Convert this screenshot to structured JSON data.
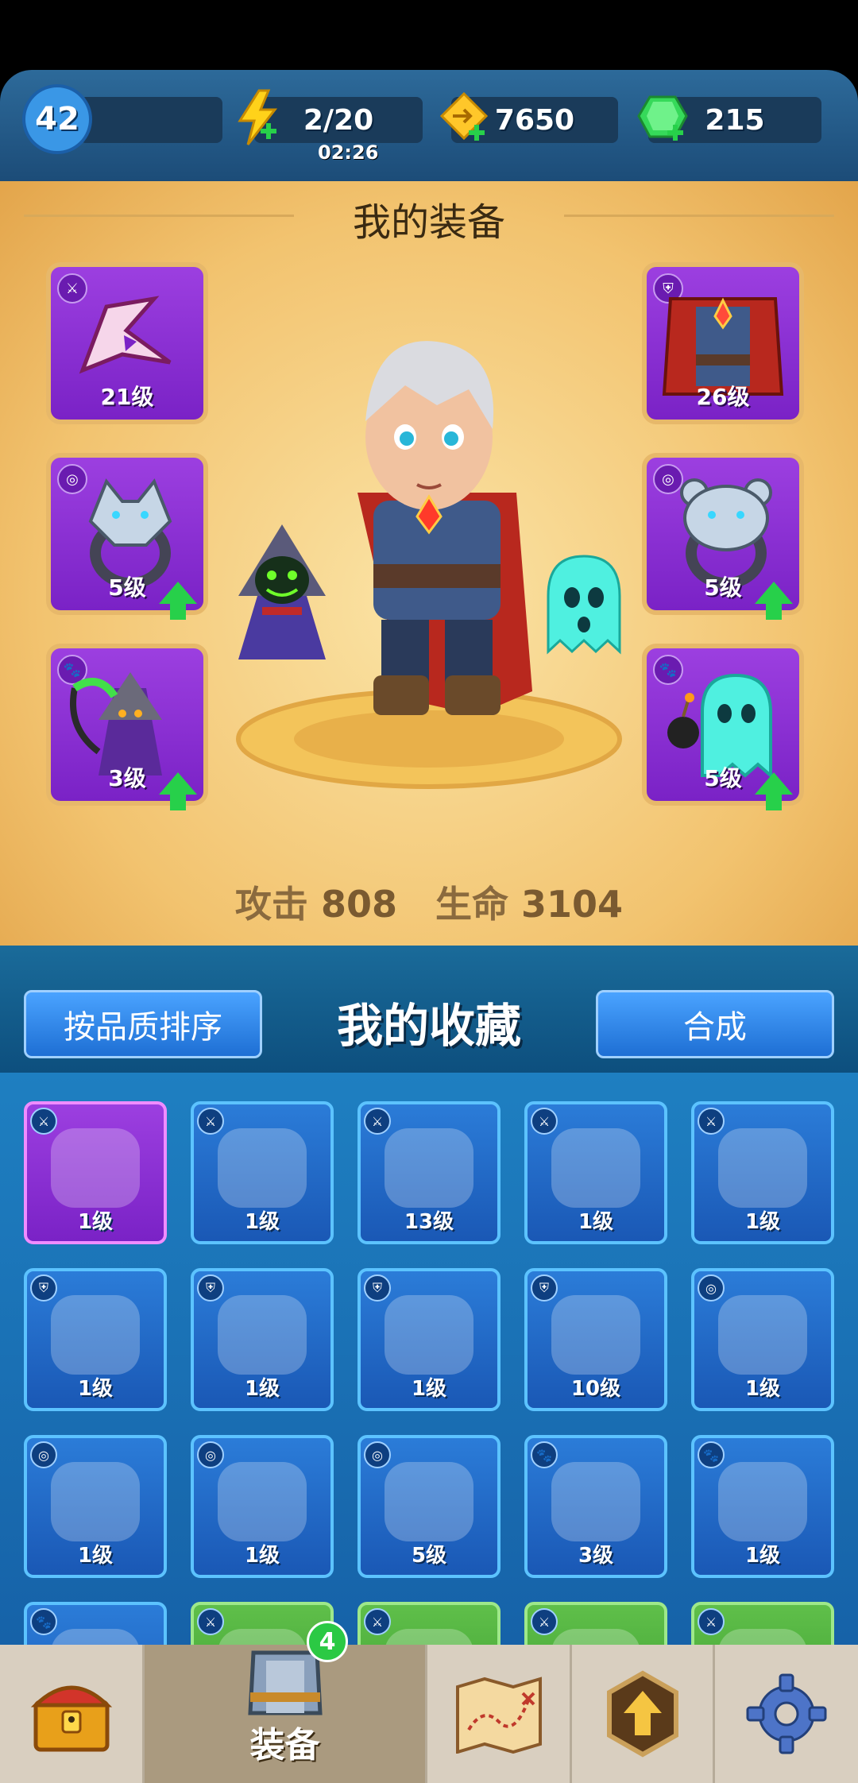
{
  "header": {
    "player_level": "42",
    "energy": "2/20",
    "energy_timer": "02:26",
    "gold": "7650",
    "gems": "215"
  },
  "equipment": {
    "title": "我的装备",
    "slots": [
      {
        "level": "21级",
        "type": "weapon",
        "upgrade": false,
        "icon": "claw-blade-icon"
      },
      {
        "level": "5级",
        "type": "ring",
        "upgrade": true,
        "icon": "wolf-ring-icon"
      },
      {
        "level": "3级",
        "type": "pet",
        "upgrade": true,
        "icon": "reaper-pet-icon"
      },
      {
        "level": "26级",
        "type": "armor",
        "upgrade": false,
        "icon": "red-cape-armor-icon"
      },
      {
        "level": "5级",
        "type": "ring",
        "upgrade": true,
        "icon": "bear-ring-icon"
      },
      {
        "level": "5级",
        "type": "pet",
        "upgrade": true,
        "icon": "ghost-bomb-pet-icon"
      }
    ],
    "stats": {
      "attack_label": "攻击",
      "attack_value": "808",
      "hp_label": "生命",
      "hp_value": "3104"
    }
  },
  "collection": {
    "title": "我的收藏",
    "sort_button": "按品质排序",
    "merge_button": "合成",
    "items": [
      {
        "level": "1级",
        "rarity": "purple",
        "type": "weapon",
        "icon": "claw-blade-icon"
      },
      {
        "level": "1级",
        "rarity": "blue",
        "type": "weapon",
        "icon": "bow-icon"
      },
      {
        "level": "13级",
        "rarity": "blue",
        "type": "weapon",
        "icon": "scythe-icon"
      },
      {
        "level": "1级",
        "rarity": "blue",
        "type": "weapon",
        "icon": "sword-icon"
      },
      {
        "level": "1级",
        "rarity": "blue",
        "type": "weapon",
        "icon": "sword-icon"
      },
      {
        "level": "1级",
        "rarity": "blue",
        "type": "armor",
        "icon": "gold-armor-icon"
      },
      {
        "level": "1级",
        "rarity": "blue",
        "type": "armor",
        "icon": "vest-armor-icon"
      },
      {
        "level": "1级",
        "rarity": "blue",
        "type": "armor",
        "icon": "red-cape-armor-icon"
      },
      {
        "level": "10级",
        "rarity": "blue",
        "type": "armor",
        "icon": "red-cape-armor-icon"
      },
      {
        "level": "1级",
        "rarity": "blue",
        "type": "ring",
        "icon": "bear-ring-icon"
      },
      {
        "level": "1级",
        "rarity": "blue",
        "type": "ring",
        "icon": "eagle-ring-icon"
      },
      {
        "level": "1级",
        "rarity": "blue",
        "type": "ring",
        "icon": "eagle-ring-icon"
      },
      {
        "level": "5级",
        "rarity": "blue",
        "type": "ring",
        "icon": "snake-ring-icon"
      },
      {
        "level": "3级",
        "rarity": "blue",
        "type": "pet",
        "icon": "fairy-pet-icon"
      },
      {
        "level": "1级",
        "rarity": "blue",
        "type": "pet",
        "icon": "ghost-bomb-pet-icon"
      },
      {
        "level": "",
        "rarity": "blue",
        "type": "pet",
        "icon": "pet-icon"
      },
      {
        "level": "",
        "rarity": "green",
        "type": "weapon",
        "icon": "weapon-icon"
      },
      {
        "level": "",
        "rarity": "green",
        "type": "weapon",
        "icon": "weapon-icon"
      },
      {
        "level": "",
        "rarity": "green",
        "type": "weapon",
        "icon": "weapon-icon"
      },
      {
        "level": "",
        "rarity": "green",
        "type": "weapon",
        "icon": "weapon-icon"
      }
    ]
  },
  "navbar": {
    "items": [
      {
        "name": "shop",
        "icon": "treasure-chest-icon",
        "label": ""
      },
      {
        "name": "equipment",
        "icon": "armor-icon",
        "label": "装备",
        "badge": "4"
      },
      {
        "name": "map",
        "icon": "map-icon",
        "label": ""
      },
      {
        "name": "upgrade",
        "icon": "upgrade-arrow-icon",
        "label": ""
      },
      {
        "name": "settings",
        "icon": "gear-icon",
        "label": ""
      }
    ]
  },
  "colors": {
    "rare_purple": "#8a2fd3",
    "common_blue": "#1f6bc6",
    "uncommon_green": "#4aa83a",
    "panel_gold": "#f2c36f"
  }
}
